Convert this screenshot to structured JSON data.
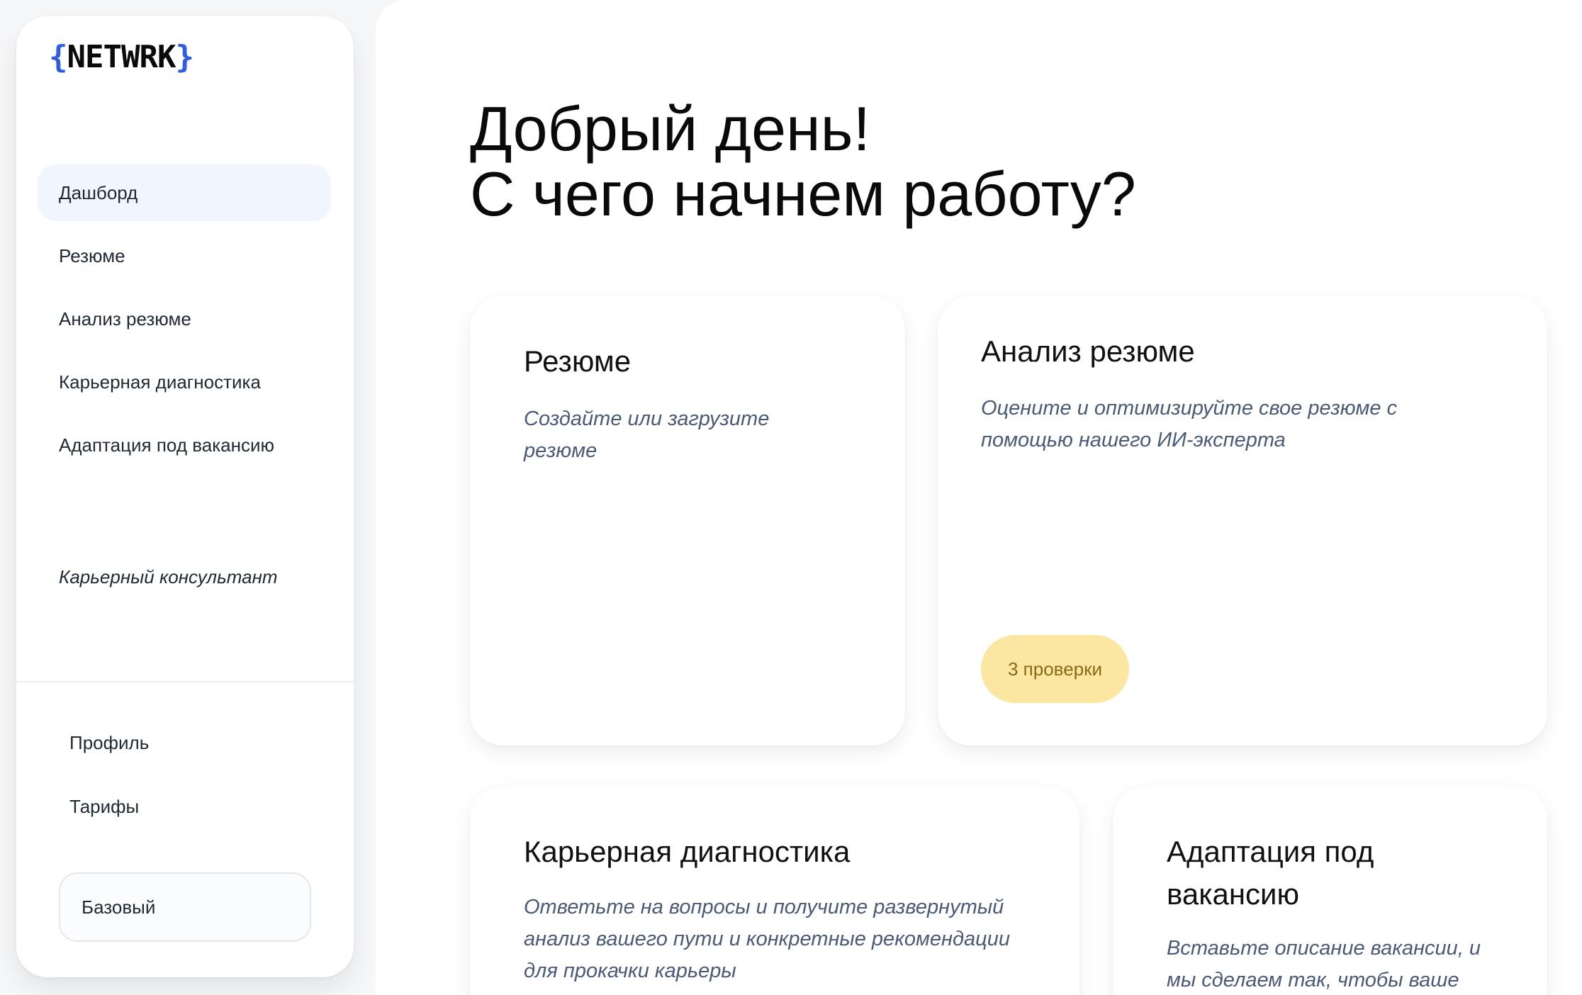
{
  "sidebar": {
    "logo": {
      "open_brace": "{",
      "name": "NETWRK",
      "close_brace": "}",
      "brace_color": "#2f5fe0"
    },
    "nav_items": [
      {
        "label": "Дашборд",
        "active": true
      },
      {
        "label": "Резюме",
        "active": false
      },
      {
        "label": "Анализ резюме",
        "active": false
      },
      {
        "label": "Карьерная диагностика",
        "active": false
      },
      {
        "label": "Адаптация под вакансию",
        "active": false
      }
    ],
    "consultant_label": "Карьерный консультант",
    "bottom_items": [
      {
        "label": "Профиль"
      },
      {
        "label": "Тарифы"
      }
    ],
    "plan_label": "Базовый"
  },
  "main": {
    "greeting_line1": "Добрый день!",
    "greeting_line2": "С чего начнем работу?",
    "cards": [
      {
        "title": "Резюме",
        "description": "Создайте или загрузите резюме"
      },
      {
        "title": "Анализ резюме",
        "description": "Оцените и оптимизируйте свое резюме с помощью нашего ИИ-эксперта",
        "badge": "3 проверки"
      },
      {
        "title": "Карьерная диагностика",
        "description": "Ответьте на вопросы и получите развернутый анализ вашего пути и конкретные рекомендации для прокачки карьеры"
      },
      {
        "title": "Адаптация под вакансию",
        "description": "Вставьте описание вакансии, и мы сделаем так, чтобы ваше"
      }
    ]
  },
  "colors": {
    "accent": "#2f5fe0",
    "active_nav_bg": "#f0f5ff",
    "badge_bg": "#fbe7a1",
    "badge_text": "#8a6a16",
    "description_text": "#4a5a78"
  }
}
